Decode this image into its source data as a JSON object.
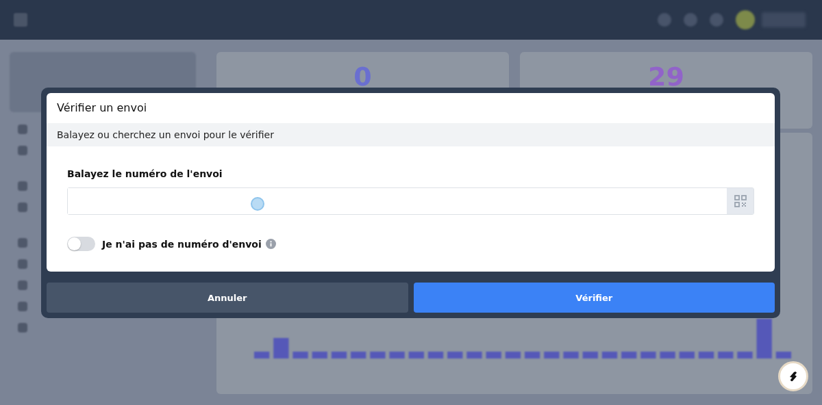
{
  "stats": [
    {
      "value": "0",
      "color": "#6a6fd0"
    },
    {
      "value": "29",
      "color": "#9163c9"
    }
  ],
  "dialog": {
    "title": "Vérifier un envoi",
    "subtitle": "Balayez ou cherchez un envoi pour le vérifier",
    "field_label": "Balayez le numéro de l'envoi",
    "toggle": {
      "label": "Je n'ai pas de numéro d'envoi",
      "on": false
    },
    "buttons": [
      {
        "label": "Annuler",
        "kind": "secondary"
      },
      {
        "label": "Vérifier",
        "kind": "primary"
      }
    ]
  }
}
